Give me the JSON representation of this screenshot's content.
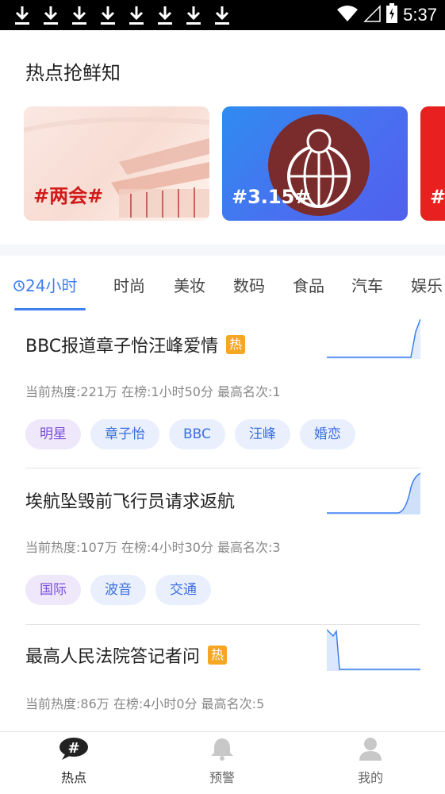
{
  "status_bar": {
    "download_icons": [
      "download-icon",
      "download-icon",
      "download-icon",
      "download-icon",
      "download-icon",
      "download-icon",
      "download-icon",
      "download-icon"
    ],
    "time": "5:37"
  },
  "hot_section": {
    "title": "热点抢鲜知",
    "cards": [
      {
        "label": "#两会#"
      },
      {
        "label": "#3.15#"
      },
      {
        "label": "#"
      }
    ]
  },
  "tabs": [
    {
      "label": "24小时",
      "active": true
    },
    {
      "label": "时尚"
    },
    {
      "label": "美妆"
    },
    {
      "label": "数码"
    },
    {
      "label": "食品"
    },
    {
      "label": "汽车"
    },
    {
      "label": "娱乐"
    }
  ],
  "items": [
    {
      "title": "BBC报道章子怡汪峰爱情",
      "hot": "热",
      "meta": "当前热度:221万   在榜:1小时50分   最高名次:1",
      "tags": [
        {
          "label": "明星",
          "style": "purple"
        },
        {
          "label": "章子怡",
          "style": "blue"
        },
        {
          "label": "BBC",
          "style": "blue"
        },
        {
          "label": "汪峰",
          "style": "blue"
        },
        {
          "label": "婚恋",
          "style": "blue"
        }
      ]
    },
    {
      "title": "埃航坠毁前飞行员请求返航",
      "hot": "",
      "meta": "当前热度:107万   在榜:4小时30分   最高名次:3",
      "tags": [
        {
          "label": "国际",
          "style": "purple"
        },
        {
          "label": "波音",
          "style": "blue"
        },
        {
          "label": "交通",
          "style": "blue"
        }
      ]
    },
    {
      "title": "最高人民法院答记者问",
      "hot": "热",
      "meta": "当前热度:86万   在榜:4小时0分   最高名次:5",
      "tags": []
    }
  ],
  "bottom_nav": [
    {
      "label": "热点",
      "icon": "hashtag-chat-icon",
      "active": true
    },
    {
      "label": "预警",
      "icon": "bell-icon"
    },
    {
      "label": "我的",
      "icon": "person-icon"
    }
  ],
  "colors": {
    "accent": "#3b7ff0",
    "hot_badge": "#f5a623"
  }
}
